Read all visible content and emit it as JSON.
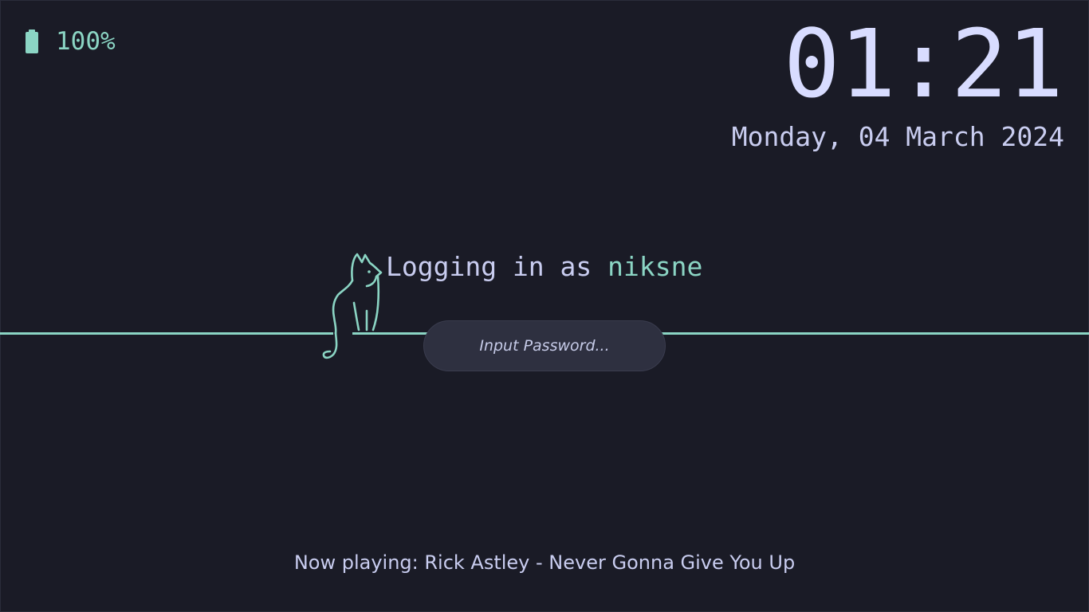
{
  "battery": {
    "icon": "battery-full-icon",
    "percent_text": "100%",
    "color": "#8bd5c4"
  },
  "clock": {
    "time": "01:21",
    "date": "Monday, 04 March 2024"
  },
  "login": {
    "prefix": "Logging in as",
    "username": "niksne",
    "mascot_icon": "cat-outline-icon"
  },
  "password": {
    "placeholder": "Input Password...",
    "value": ""
  },
  "media": {
    "now_playing": "Now playing: Rick Astley - Never Gonna Give You Up"
  },
  "colors": {
    "background": "#1a1b26",
    "accent": "#8bd5c4",
    "text": "#c9cdf0",
    "input_background": "#2e3040"
  }
}
